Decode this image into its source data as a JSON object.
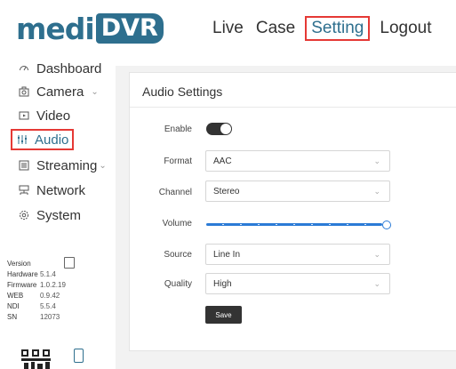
{
  "logo": {
    "prefix": "medi",
    "suffix": "DVR"
  },
  "topnav": {
    "live": "Live",
    "case": "Case",
    "setting": "Setting",
    "logout": "Logout"
  },
  "sidebar": {
    "items": [
      {
        "label": "Dashboard",
        "icon": "dashboard-icon"
      },
      {
        "label": "Camera",
        "icon": "camera-icon",
        "chevron": "⌄"
      },
      {
        "label": "Video",
        "icon": "video-icon"
      },
      {
        "label": "Audio",
        "icon": "audio-icon"
      },
      {
        "label": "Streaming",
        "icon": "streaming-icon",
        "chevron": "⌄"
      },
      {
        "label": "Network",
        "icon": "network-icon"
      },
      {
        "label": "System",
        "icon": "system-icon"
      }
    ]
  },
  "version": {
    "title": "Version",
    "rows": [
      {
        "k": "Hardware",
        "v": "5.1.4"
      },
      {
        "k": "Firmware",
        "v": "1.0.2.19"
      },
      {
        "k": "WEB",
        "v": "0.9.42"
      },
      {
        "k": "NDI",
        "v": "5.5.4"
      },
      {
        "k": "SN",
        "v": "12073"
      }
    ]
  },
  "audio": {
    "title": "Audio Settings",
    "enable_label": "Enable",
    "enabled": true,
    "format_label": "Format",
    "format_value": "AAC",
    "channel_label": "Channel",
    "channel_value": "Stereo",
    "volume_label": "Volume",
    "volume_level": 1.0,
    "source_label": "Source",
    "source_value": "Line In",
    "quality_label": "Quality",
    "quality_value": "High",
    "save_label": "Save"
  },
  "colors": {
    "brand": "#2e6f8e",
    "accent": "#2b7bd6",
    "highlight": "#e53935"
  }
}
